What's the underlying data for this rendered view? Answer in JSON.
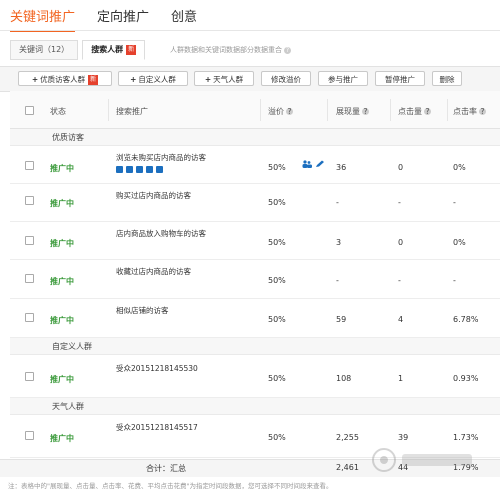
{
  "top_tabs": [
    "关键词推广",
    "定向推广",
    "创意"
  ],
  "sub_tabs": {
    "keyword_label": "关键词（12）",
    "crowd_label": "搜索人群",
    "new_badge": "新",
    "note": "人群数据和关键词数据部分数据重合"
  },
  "toolbar": {
    "quality_crowd": "优质访客人群",
    "quality_badge": "新",
    "custom_crowd": "自定义人群",
    "weather_crowd": "天气人群",
    "edit_premium": "修改溢价",
    "join": "参与推广",
    "pause": "暂停推广",
    "delete": "删除"
  },
  "columns": {
    "status": "状态",
    "search_crowd": "搜索推广",
    "premium": "溢价",
    "impressions": "展现量",
    "clicks": "点击量",
    "ctr": "点击率"
  },
  "groups": {
    "quality": "优质访客",
    "custom": "自定义人群",
    "weather": "天气人群"
  },
  "rows": [
    {
      "status": "推广中",
      "name": "浏览未购买店内商品的访客",
      "premium": "50%",
      "impressions": "36",
      "clicks": "0",
      "ctr": "0%"
    },
    {
      "status": "推广中",
      "name": "购买过店内商品的访客",
      "premium": "50%",
      "impressions": "-",
      "clicks": "-",
      "ctr": "-"
    },
    {
      "status": "推广中",
      "name": "店内商品放入购物车的访客",
      "premium": "50%",
      "impressions": "3",
      "clicks": "0",
      "ctr": "0%"
    },
    {
      "status": "推广中",
      "name": "收藏过店内商品的访客",
      "premium": "50%",
      "impressions": "-",
      "clicks": "-",
      "ctr": "-"
    },
    {
      "status": "推广中",
      "name": "相似店铺的访客",
      "premium": "50%",
      "impressions": "59",
      "clicks": "4",
      "ctr": "6.78%"
    },
    {
      "status": "推广中",
      "name": "受众20151218145530",
      "premium": "50%",
      "impressions": "108",
      "clicks": "1",
      "ctr": "0.93%"
    },
    {
      "status": "推广中",
      "name": "受众20151218145517",
      "premium": "50%",
      "impressions": "2,255",
      "clicks": "39",
      "ctr": "1.73%"
    }
  ],
  "total": {
    "label": "合计：汇总",
    "impressions": "2,461",
    "clicks": "44",
    "ctr": "1.79%"
  },
  "footnote": "注：表格中的\"展现量、点击量、点击率、花费、平均点击花费\"为指定时间段数据，您可选择不同时间段来查看。",
  "colors": {
    "accent": "#f26522",
    "status_green": "#3b9a3b",
    "badge_red": "#e5412d",
    "icon_blue": "#1c6fbf"
  }
}
